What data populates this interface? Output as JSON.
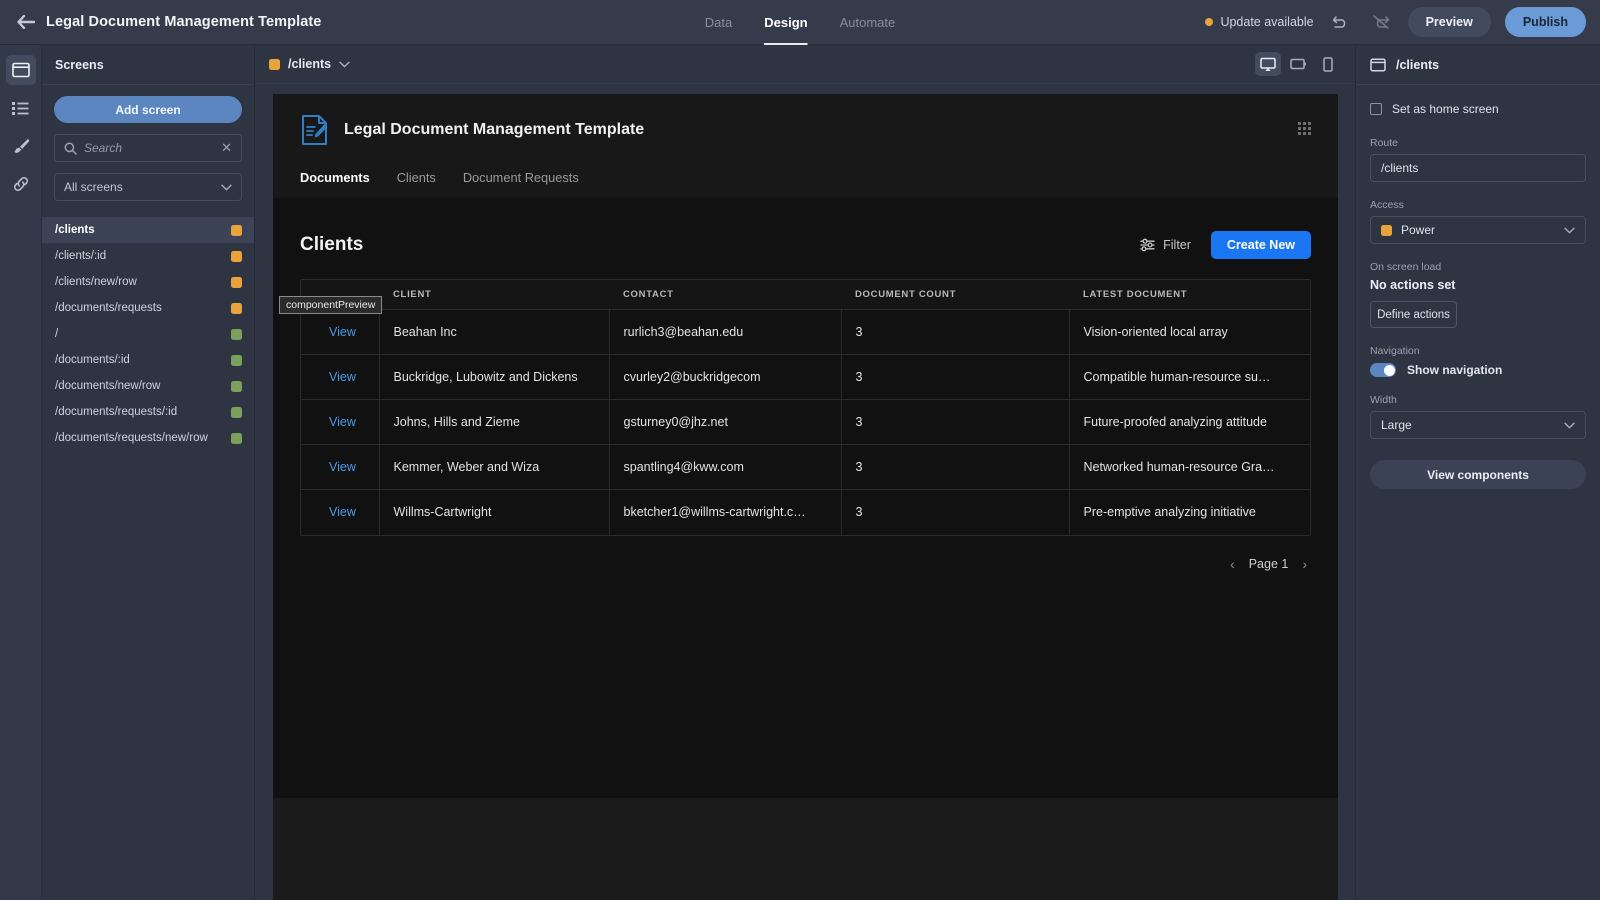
{
  "topbar": {
    "back_icon": "back-arrow-icon",
    "title": "Legal Document Management Template",
    "tabs": [
      {
        "label": "Data",
        "active": false
      },
      {
        "label": "Design",
        "active": true
      },
      {
        "label": "Automate",
        "active": false
      }
    ],
    "update_label": "Update available",
    "update_dot_color": "#e8a33d",
    "undo_icon": "undo-icon",
    "redo_icon": "redo-disabled-icon",
    "preview_label": "Preview",
    "publish_label": "Publish",
    "publish_color": "#6b9bd6"
  },
  "rail": {
    "items": [
      {
        "icon": "screens-icon",
        "active": true
      },
      {
        "icon": "list-icon",
        "active": false
      },
      {
        "icon": "paintbrush-icon",
        "active": false
      },
      {
        "icon": "link-icon",
        "active": false
      }
    ]
  },
  "screens": {
    "heading": "Screens",
    "add_button": "Add screen",
    "search_placeholder": "Search",
    "filter_value": "All screens",
    "items": [
      {
        "route": "/clients",
        "color": "#e8a33d",
        "selected": true
      },
      {
        "route": "/clients/:id",
        "color": "#e8a33d",
        "selected": false
      },
      {
        "route": "/clients/new/row",
        "color": "#e8a33d",
        "selected": false
      },
      {
        "route": "/documents/requests",
        "color": "#e8a33d",
        "selected": false
      },
      {
        "route": "/",
        "color": "#7ba05b",
        "selected": false
      },
      {
        "route": "/documents/:id",
        "color": "#7ba05b",
        "selected": false
      },
      {
        "route": "/documents/new/row",
        "color": "#7ba05b",
        "selected": false
      },
      {
        "route": "/documents/requests/:id",
        "color": "#7ba05b",
        "selected": false
      },
      {
        "route": "/documents/requests/new/row",
        "color": "#7ba05b",
        "selected": false
      }
    ]
  },
  "canvas": {
    "route_chip": "/clients",
    "route_chip_color": "#e8a33d",
    "devices": [
      {
        "name": "desktop-device-icon",
        "active": true
      },
      {
        "name": "tablet-device-icon",
        "active": false
      },
      {
        "name": "mobile-device-icon",
        "active": false
      }
    ]
  },
  "app": {
    "logo_icon": "document-pen-icon",
    "brand_name": "Legal Document Management Template",
    "tabs": [
      {
        "label": "Documents",
        "active": true
      },
      {
        "label": "Clients",
        "active": false
      },
      {
        "label": "Document Requests",
        "active": false
      }
    ],
    "grid_icon": "grid-dots-icon",
    "page_title": "Clients",
    "filter_label": "Filter",
    "filter_icon": "filter-sliders-icon",
    "create_new_label": "Create New",
    "create_new_color": "#1a76f2",
    "component_tooltip": "componentPreview",
    "table": {
      "action_header": "",
      "columns": [
        "CLIENT",
        "CONTACT",
        "DOCUMENT COUNT",
        "LATEST DOCUMENT"
      ],
      "action_label": "View",
      "rows": [
        {
          "action": "View",
          "client": "Beahan Inc",
          "contact": "rurlich3@beahan.edu",
          "document_count": "3",
          "latest_document": "Vision-oriented local array"
        },
        {
          "action": "View",
          "client": "Buckridge, Lubowitz and Dickens",
          "contact": "cvurley2@buckridgecom",
          "document_count": "3",
          "latest_document": "Compatible human-resource su…"
        },
        {
          "action": "View",
          "client": "Johns, Hills and Zieme",
          "contact": "gsturney0@jhz.net",
          "document_count": "3",
          "latest_document": "Future-proofed analyzing attitude"
        },
        {
          "action": "View",
          "client": "Kemmer, Weber and Wiza",
          "contact": "spantling4@kww.com",
          "document_count": "3",
          "latest_document": "Networked human-resource Gra…"
        },
        {
          "action": "View",
          "client": "Willms-Cartwright",
          "contact": "bketcher1@willms-cartwright.c…",
          "document_count": "3",
          "latest_document": "Pre-emptive analyzing initiative"
        }
      ]
    },
    "pagination": {
      "prev_icon": "chevron-left-icon",
      "page_label": "Page 1",
      "next_icon": "chevron-right-icon"
    }
  },
  "inspector": {
    "header_icon": "screen-icon",
    "header_title": "/clients",
    "home_checkbox_label": "Set as home screen",
    "route_label": "Route",
    "route_value": "/clients",
    "access_label": "Access",
    "access_value": "Power",
    "access_color": "#e8a33d",
    "onload_label": "On screen load",
    "onload_value": "No actions set",
    "define_actions_label": "Define actions",
    "navigation_label": "Navigation",
    "show_navigation_label": "Show navigation",
    "show_navigation_on": true,
    "width_label": "Width",
    "width_value": "Large",
    "view_components_label": "View components"
  }
}
